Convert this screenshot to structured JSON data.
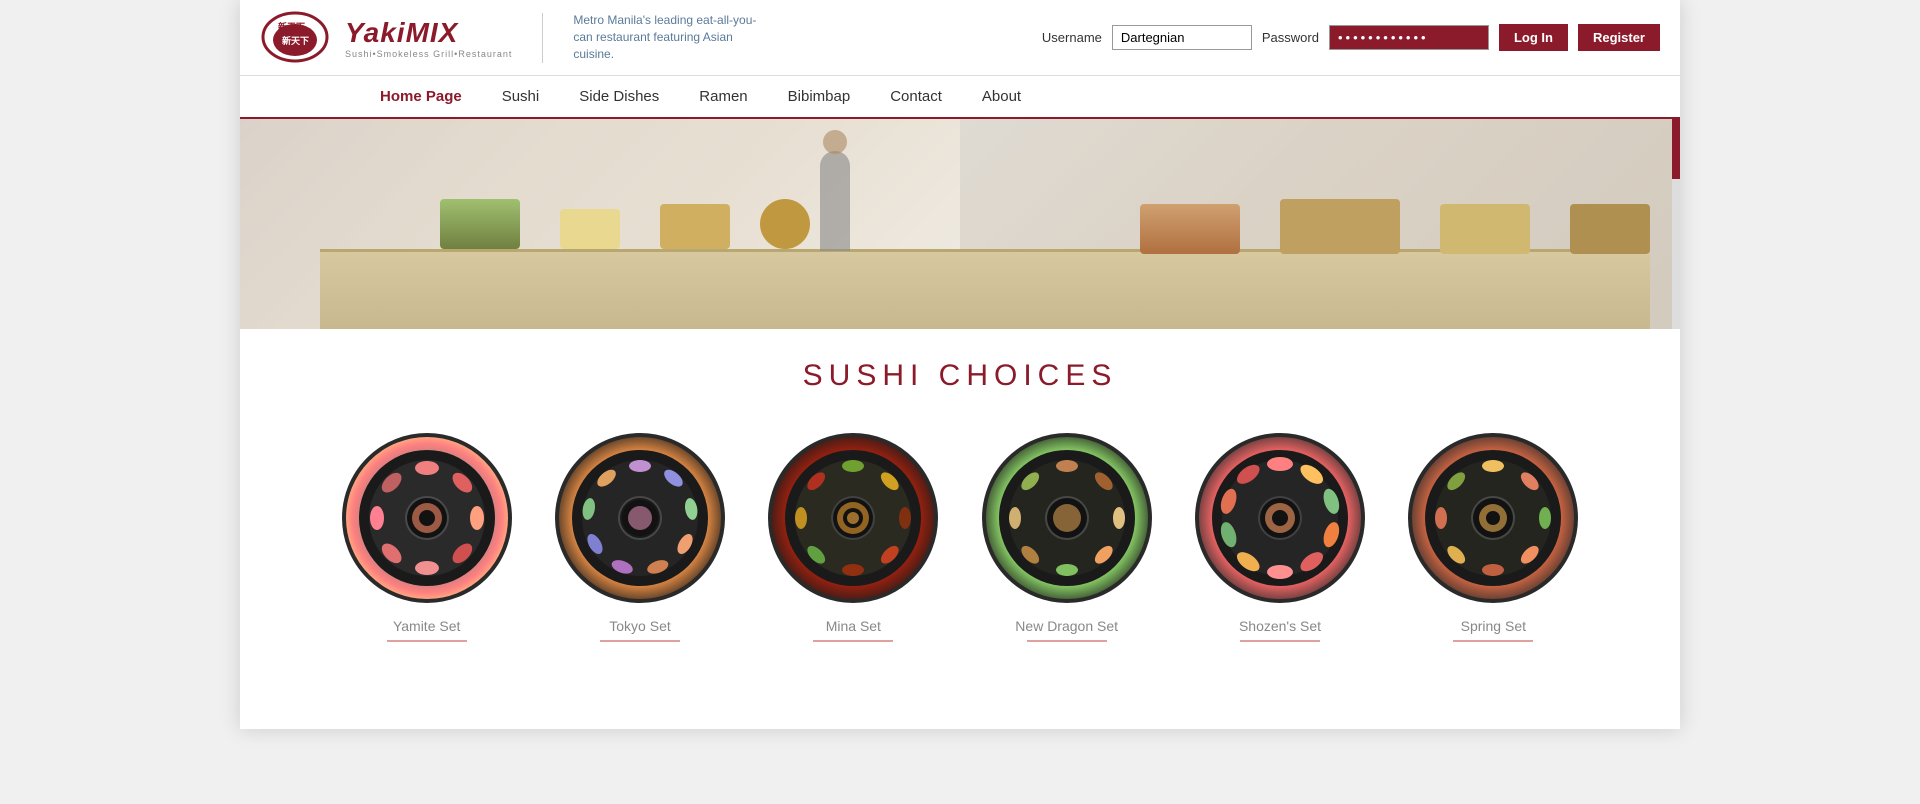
{
  "header": {
    "username_label": "Username",
    "password_label": "Password",
    "username_value": "Dartegnian",
    "password_value": "••••••••••••••••••",
    "login_button": "Log In",
    "register_button": "Register",
    "logo_main": "YakiMIX",
    "logo_sub": "Sushi•Smokeless Grill•Restaurant",
    "logo_tagline": "Metro Manila's leading eat-all-you-can restaurant featuring Asian cuisine."
  },
  "nav": {
    "items": [
      {
        "label": "Home Page",
        "active": true
      },
      {
        "label": "Sushi",
        "active": false
      },
      {
        "label": "Side Dishes",
        "active": false
      },
      {
        "label": "Ramen",
        "active": false
      },
      {
        "label": "Bibimbap",
        "active": false
      },
      {
        "label": "Contact",
        "active": false
      },
      {
        "label": "About",
        "active": false
      }
    ]
  },
  "main": {
    "section_title": "SUSHI CHOICES",
    "sushi_items": [
      {
        "name": "Yamite Set",
        "class": "sushi-yamite"
      },
      {
        "name": "Tokyo Set",
        "class": "sushi-tokyo"
      },
      {
        "name": "Mina Set",
        "class": "sushi-mina"
      },
      {
        "name": "New Dragon Set",
        "class": "sushi-dragon"
      },
      {
        "name": "Shozen's Set",
        "class": "sushi-shozen"
      },
      {
        "name": "Spring Set",
        "class": "sushi-spring"
      }
    ]
  }
}
